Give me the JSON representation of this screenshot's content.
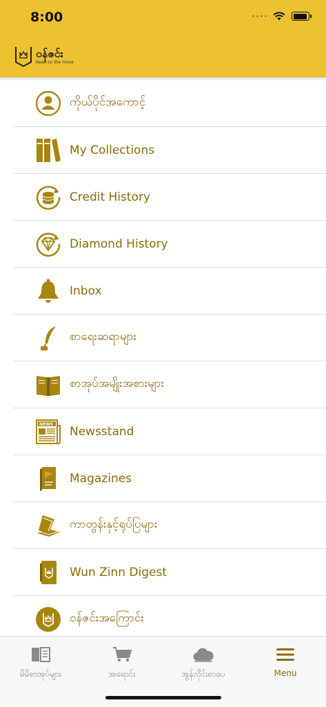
{
  "status_bar": {
    "time": "8:00"
  },
  "app": {
    "logo_title": "ဝန်ဇင်း",
    "logo_tagline": "Read on the move"
  },
  "menu": {
    "items": [
      {
        "label": "ကိုယ်ပိုင်အကောင့်",
        "icon": "profile-icon"
      },
      {
        "label": "My Collections",
        "icon": "books-icon"
      },
      {
        "label": "Credit History",
        "icon": "coins-history-icon"
      },
      {
        "label": "Diamond History",
        "icon": "diamond-history-icon"
      },
      {
        "label": "Inbox",
        "icon": "bell-icon"
      },
      {
        "label": "စာရေးဆရာများ",
        "icon": "quill-icon"
      },
      {
        "label": "စာအုပ်အမျိုးအစားများ",
        "icon": "open-book-icon"
      },
      {
        "label": "Newsstand",
        "icon": "newspaper-icon"
      },
      {
        "label": "Magazines",
        "icon": "magazine-icon"
      },
      {
        "label": "ကာတွန်းနှင့်ရုပ်ပြများ",
        "icon": "comics-icon"
      },
      {
        "label": "Wun Zinn Digest",
        "icon": "digest-icon"
      },
      {
        "label": "ဝန်ဇင်းအကြောင်း",
        "icon": "about-icon"
      }
    ]
  },
  "tabbar": {
    "tabs": [
      {
        "label": "မိမိစာအုပ်များ",
        "icon": "library-icon",
        "active": false
      },
      {
        "label": "အရောင်း",
        "icon": "cart-icon",
        "active": false
      },
      {
        "label": "အွန်လိုင်းစာပေ",
        "icon": "cloud-icon",
        "active": false
      },
      {
        "label": "Menu",
        "icon": "hamburger-icon",
        "active": true
      }
    ]
  },
  "colors": {
    "header": "#ECC231",
    "accent": "#8B6A0A",
    "icon_gold": "#A8860F"
  }
}
